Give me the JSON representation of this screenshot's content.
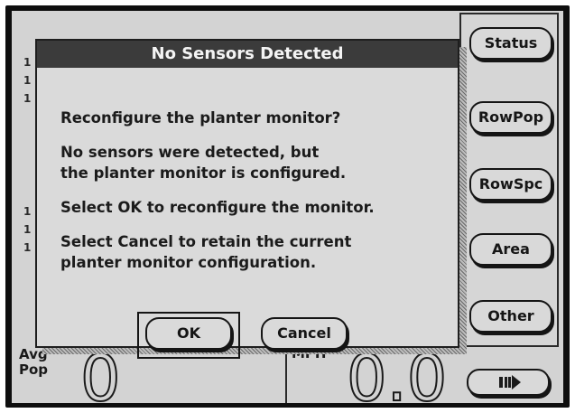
{
  "dialog": {
    "title": "No Sensors Detected",
    "question": "Reconfigure the planter monitor?",
    "message_line1": "No sensors were detected, but",
    "message_line2": "the planter monitor is configured.",
    "ok_instruction": "Select OK to reconfigure the monitor.",
    "cancel_instruction_line1": "Select Cancel to retain the current",
    "cancel_instruction_line2": "planter monitor configuration.",
    "ok_label": "OK",
    "cancel_label": "Cancel"
  },
  "softkeys": [
    {
      "label": "Status"
    },
    {
      "label": "RowPop"
    },
    {
      "label": "RowSpc"
    },
    {
      "label": "Area"
    },
    {
      "label": "Other"
    }
  ],
  "bottom": {
    "avg_pop_label_line1": "Avg",
    "avg_pop_label_line2": "Pop",
    "avg_pop_value": "0",
    "mph_label": "MPH",
    "mph_value": "0.0",
    "action_icon": "next-page-icon"
  }
}
